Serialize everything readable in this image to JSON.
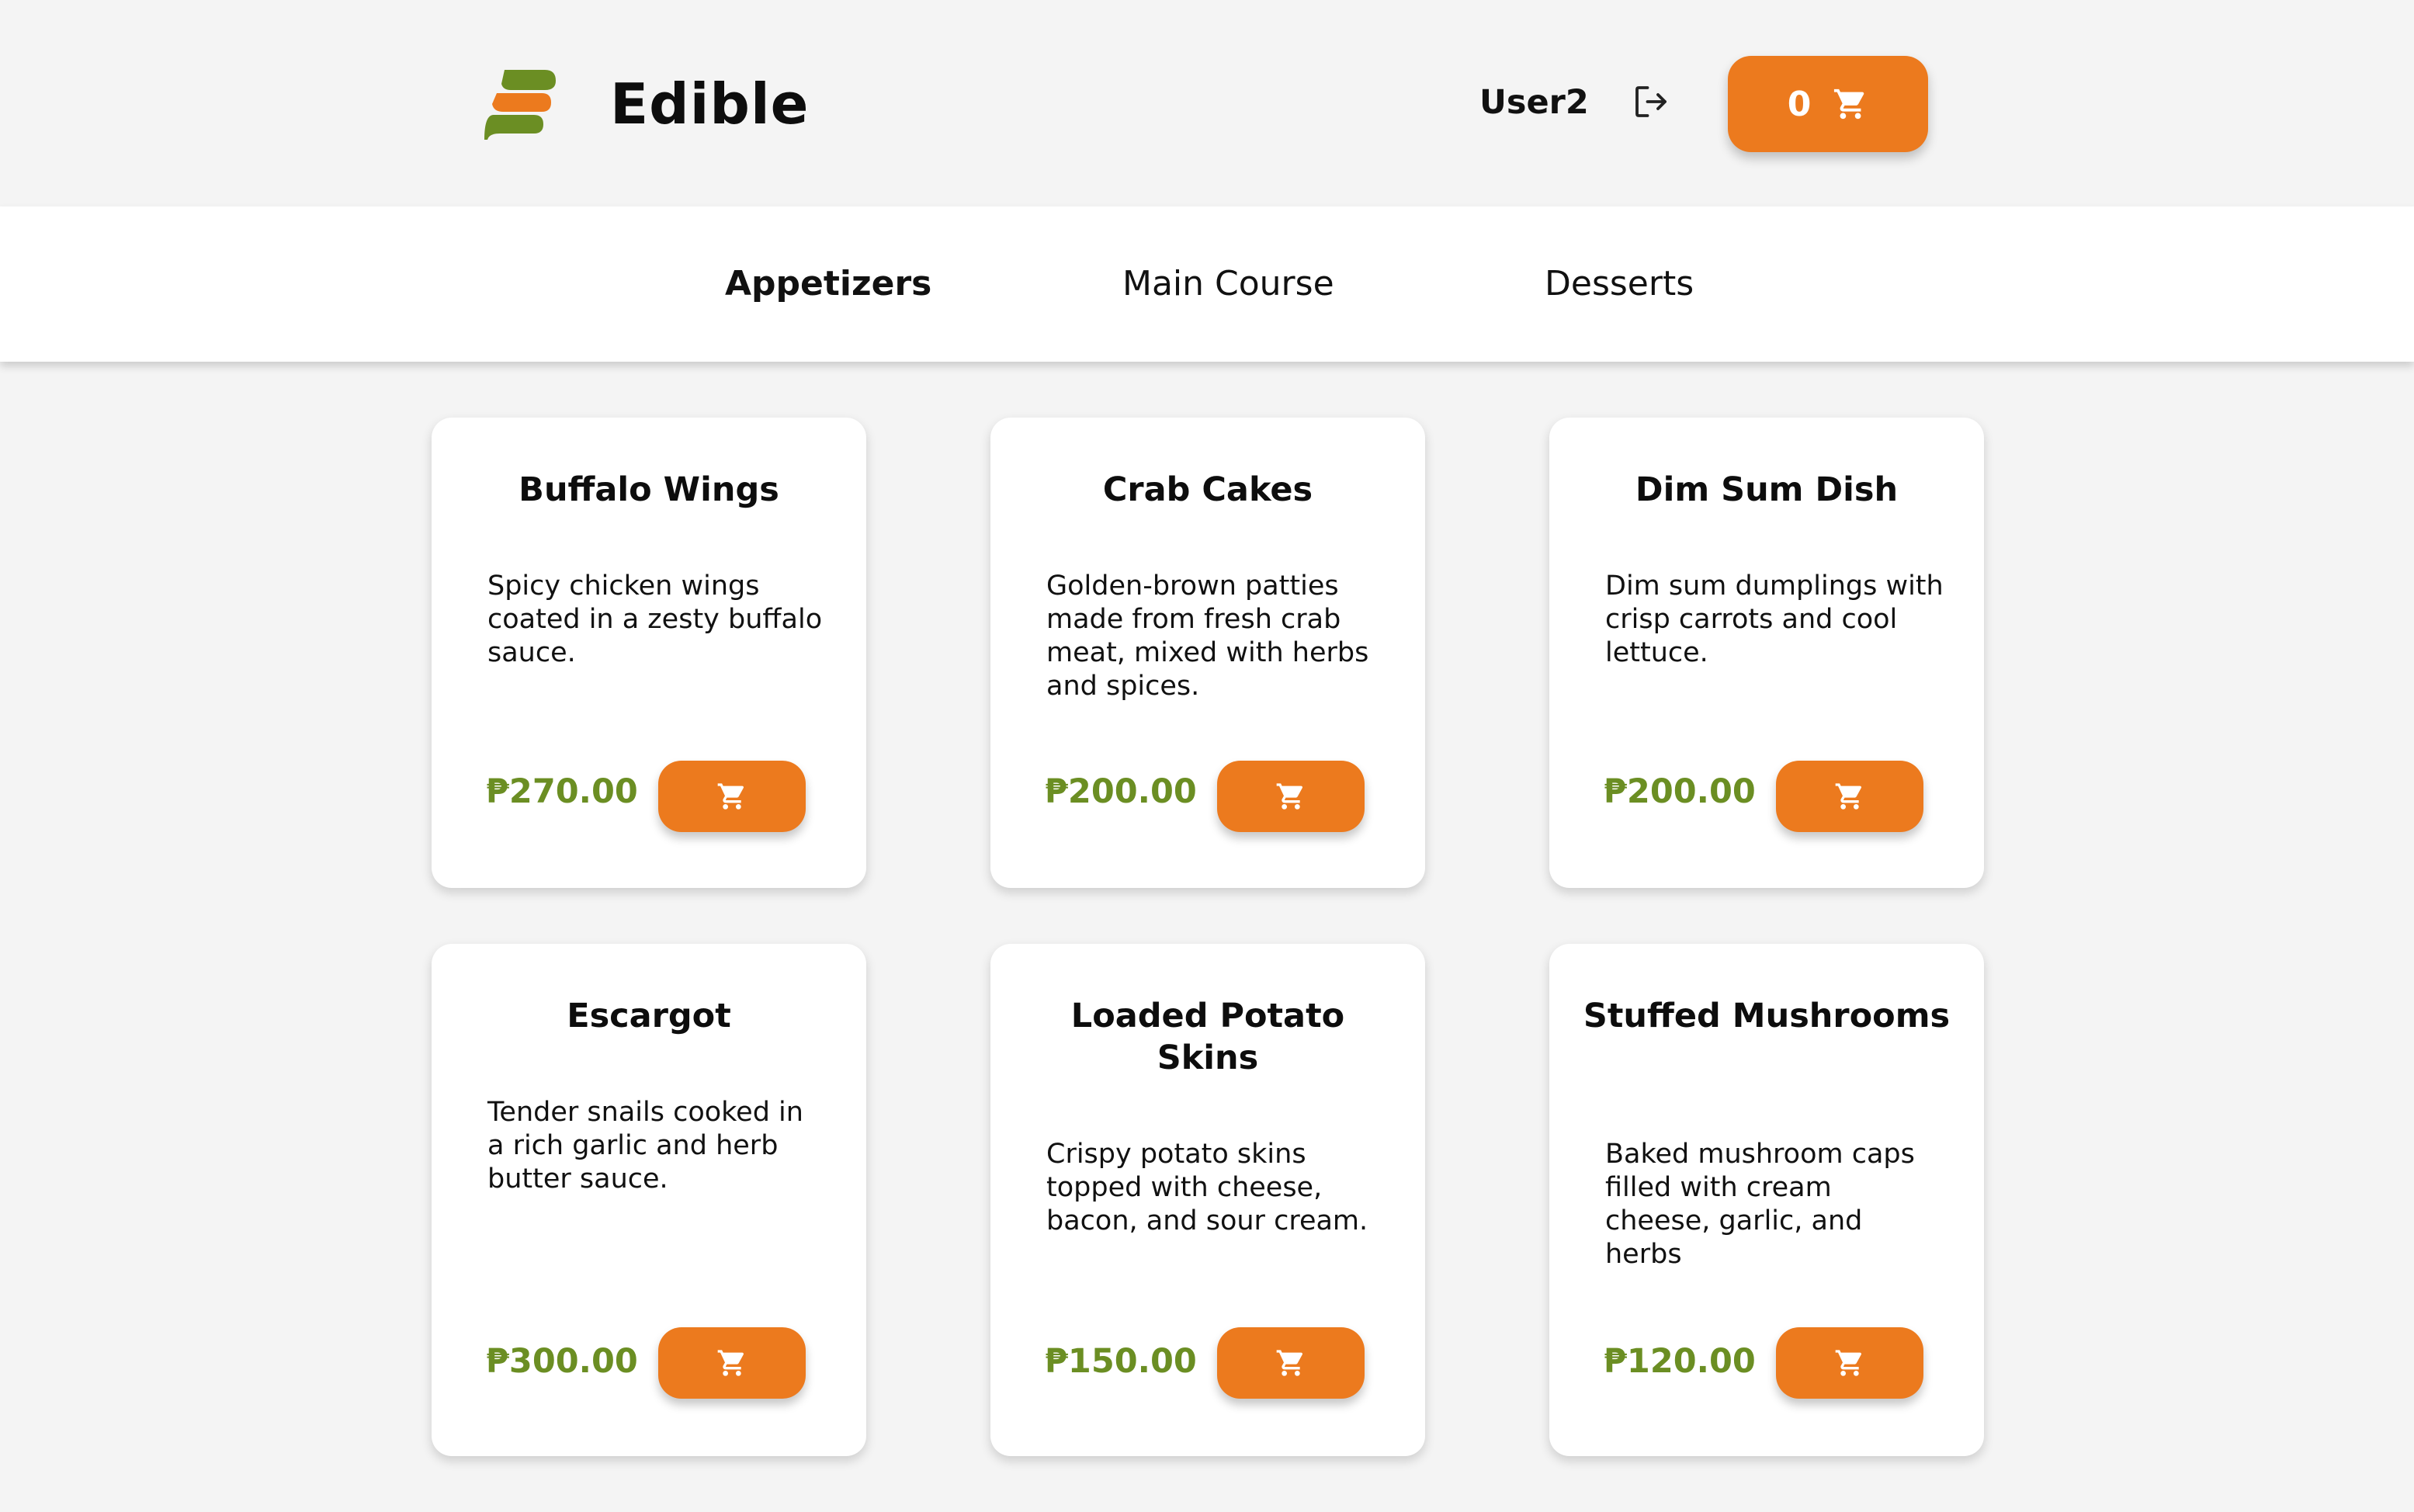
{
  "header": {
    "brand": "Edible",
    "user": "User2",
    "cart_count": "0",
    "icons": {
      "logo": "edible-logo",
      "logout": "logout-icon",
      "cart": "cart-icon"
    }
  },
  "nav": {
    "tabs": [
      {
        "label": "Appetizers",
        "active": true
      },
      {
        "label": "Main Course",
        "active": false
      },
      {
        "label": "Desserts",
        "active": false
      }
    ]
  },
  "products": [
    {
      "name": "Buffalo Wings",
      "description": "Spicy chicken wings coated in a zesty buffalo sauce.",
      "price": "₱270.00"
    },
    {
      "name": "Crab Cakes",
      "description": "Golden-brown patties made from fresh crab meat, mixed with herbs and spices.",
      "price": "₱200.00"
    },
    {
      "name": "Dim Sum Dish",
      "description": "Dim sum dumplings with crisp carrots and cool lettuce.",
      "price": "₱200.00"
    },
    {
      "name": "Escargot",
      "description": "Tender snails cooked in a rich garlic and herb butter sauce.",
      "price": "₱300.00"
    },
    {
      "name": "Loaded Potato Skins",
      "description": "Crispy potato skins topped with cheese, bacon, and sour cream.",
      "price": "₱150.00"
    },
    {
      "name": "Stuffed Mushrooms",
      "description": "Baked mushroom caps filled with cream cheese, garlic, and herbs",
      "price": "₱120.00"
    }
  ],
  "colors": {
    "accent": "#ec7a1e",
    "price": "#6b8e23",
    "logo_green": "#6b8e23",
    "background": "#f4f4f4"
  }
}
